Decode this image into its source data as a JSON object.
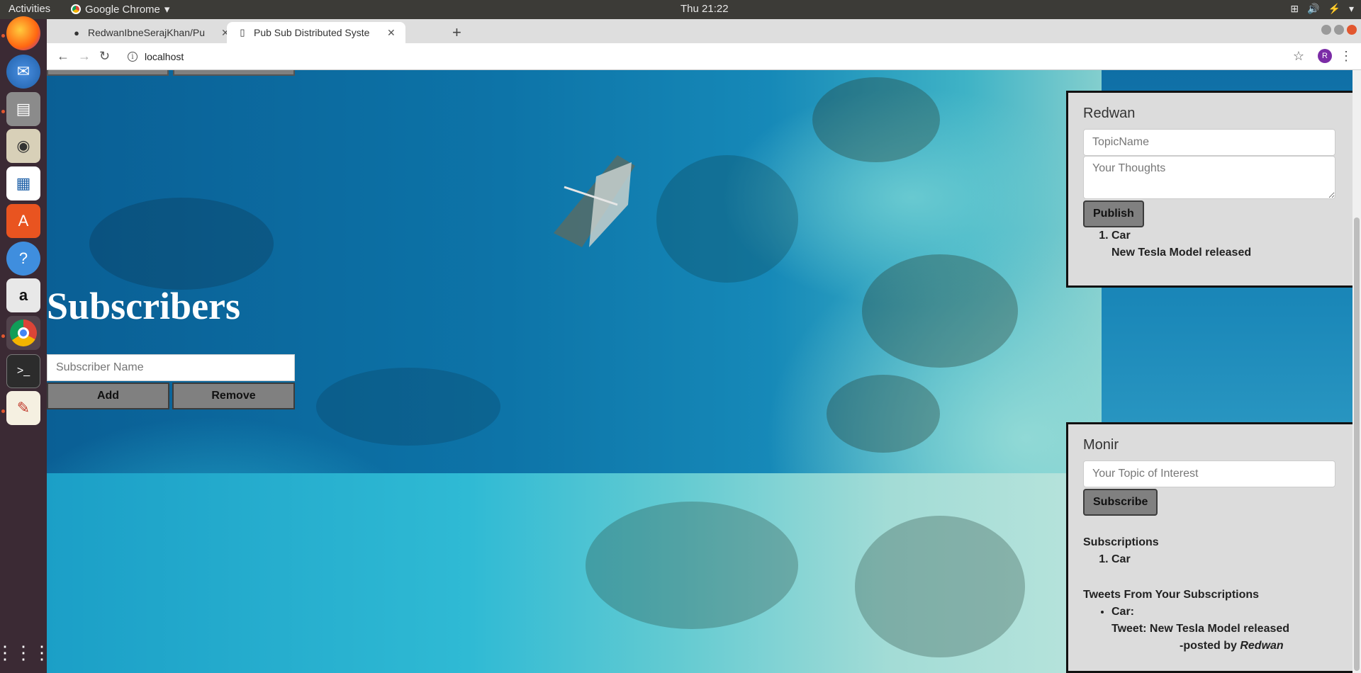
{
  "topbar": {
    "activities": "Activities",
    "app_name": "Google Chrome",
    "clock": "Thu 21:22"
  },
  "dock": {
    "items": [
      "firefox-icon",
      "thunderbird-icon",
      "files-icon",
      "rhythmbox-icon",
      "writer-icon",
      "software-icon",
      "help-icon",
      "amazon-icon",
      "chrome-icon",
      "terminal-icon",
      "text-editor-icon",
      "apps-grid-icon"
    ]
  },
  "browser": {
    "tabs": [
      {
        "title": "RedwanIbneSerajKhan/Pu"
      },
      {
        "title": "Pub Sub Distributed Syste"
      }
    ],
    "url": "localhost",
    "profile_initial": "R"
  },
  "page": {
    "subscribers": {
      "heading": "Subscribers",
      "input_placeholder": "Subscriber Name",
      "add_label": "Add",
      "remove_label": "Remove"
    },
    "publisher_card": {
      "name": "Redwan",
      "topic_placeholder": "TopicName",
      "thoughts_placeholder": "Your Thoughts",
      "publish_label": "Publish",
      "posts": [
        {
          "topic": "Car",
          "text": "New Tesla Model released"
        }
      ]
    },
    "subscriber_card": {
      "name": "Monir",
      "interest_placeholder": "Your Topic of Interest",
      "subscribe_label": "Subscribe",
      "subscriptions_label": "Subscriptions",
      "subscriptions": [
        "Car"
      ],
      "tweets_label": "Tweets From Your Subscriptions",
      "tweets": [
        {
          "topic_line": "Car:",
          "tweet_line": "Tweet: New Tesla Model released",
          "posted_by_prefix": "-posted by",
          "author": "Redwan"
        }
      ]
    }
  },
  "colors": {
    "card_bg": "#dcdcdc",
    "button_gray": "#808080",
    "dock_bg": "#3b2a34",
    "topbar_bg": "#3c3b37"
  }
}
